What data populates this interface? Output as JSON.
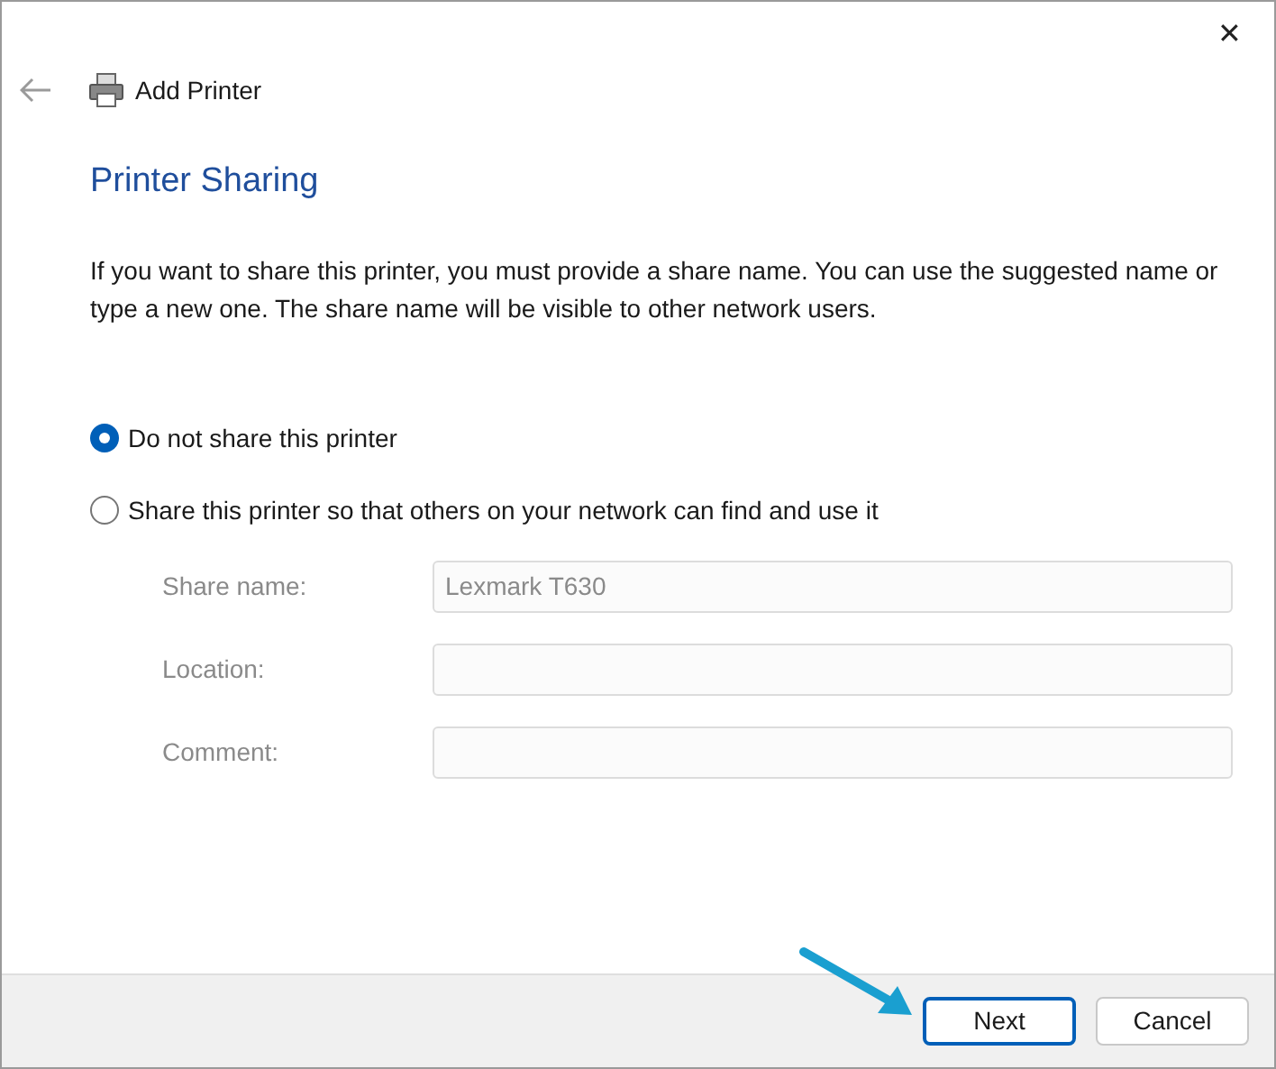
{
  "window": {
    "title": "Add Printer",
    "close": "✕"
  },
  "heading": "Printer Sharing",
  "description": "If you want to share this printer, you must provide a share name. You can use the suggested name or type a new one. The share name will be visible to other network users.",
  "options": [
    {
      "label": "Do not share this printer",
      "selected": true
    },
    {
      "label": "Share this printer so that others on your network can find and use it",
      "selected": false
    }
  ],
  "share_fields": {
    "disabled": true,
    "items": [
      {
        "label": "Share name:",
        "value": "Lexmark T630"
      },
      {
        "label": "Location:"
      },
      {
        "label": "Comment:"
      }
    ]
  },
  "buttons": [
    {
      "label": "Next",
      "default": true
    },
    {
      "label": "Cancel",
      "default": false
    }
  ]
}
